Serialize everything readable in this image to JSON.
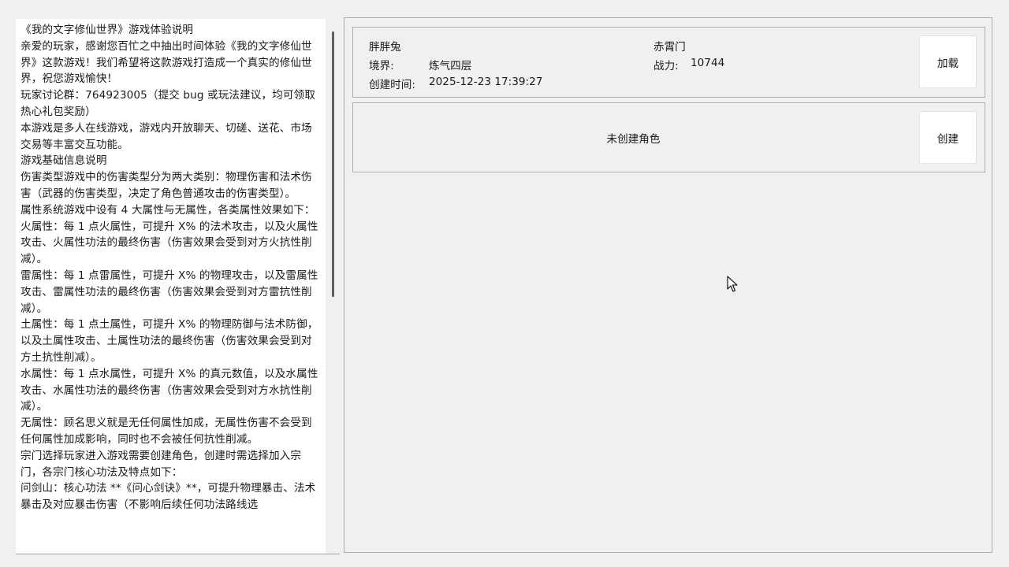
{
  "guide": {
    "paragraphs": [
      "《我的文字修仙世界》游戏体验说明",
      "亲爱的玩家，感谢您百忙之中抽出时间体验《我的文字修仙世界》这款游戏！我们希望将这款游戏打造成一个真实的修仙世界，祝您游戏愉快！",
      "玩家讨论群：764923005（提交 bug 或玩法建议，均可领取热心礼包奖励）",
      "本游戏是多人在线游戏，游戏内开放聊天、切磋、送花、市场交易等丰富交互功能。",
      "游戏基础信息说明",
      "伤害类型游戏中的伤害类型分为两大类别：物理伤害和法术伤害（武器的伤害类型，决定了角色普通攻击的伤害类型）。",
      "属性系统游戏中设有 4 大属性与无属性，各类属性效果如下：",
      "火属性：每 1 点火属性，可提升 X% 的法术攻击，以及火属性攻击、火属性功法的最终伤害（伤害效果会受到对方火抗性削减）。",
      "雷属性：每 1 点雷属性，可提升 X% 的物理攻击，以及雷属性攻击、雷属性功法的最终伤害（伤害效果会受到对方雷抗性削减）。",
      "土属性：每 1 点土属性，可提升 X% 的物理防御与法术防御，以及土属性攻击、土属性功法的最终伤害（伤害效果会受到对方土抗性削减）。",
      "水属性：每 1 点水属性，可提升 X% 的真元数值，以及水属性攻击、水属性功法的最终伤害（伤害效果会受到对方水抗性削减）。",
      "无属性：顾名思义就是无任何属性加成，无属性伤害不会受到任何属性加成影响，同时也不会被任何抗性削减。",
      "宗门选择玩家进入游戏需要创建角色，创建时需选择加入宗门，各宗门核心功法及特点如下：",
      "问剑山：核心功法 **《问心剑诀》**，可提升物理暴击、法术暴击及对应暴击伤害（不影响后续任何功法路线选"
    ]
  },
  "slot1": {
    "name": "胖胖兔",
    "realm_label": "境界:",
    "realm_value": "炼气四层",
    "created_label": "创建时间:",
    "created_value": "2025-12-23 17:39:27",
    "sect": "赤霄门",
    "power_label": "战力:",
    "power_value": "10744",
    "button_label": "加载"
  },
  "slot2": {
    "empty_label": "未创建角色",
    "button_label": "创建"
  }
}
